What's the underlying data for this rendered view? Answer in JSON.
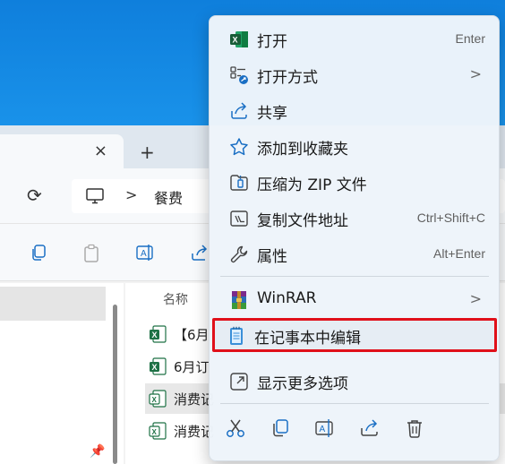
{
  "explorer": {
    "tab_close": "×",
    "tab_new": "+",
    "refresh": "⟳",
    "breadcrumb_separator": ">",
    "breadcrumb_folder": "餐费",
    "column_name_header": "名称",
    "files": [
      {
        "name": "【6月",
        "type": "excel",
        "selected": false
      },
      {
        "name": "6月订",
        "type": "excel",
        "selected": false
      },
      {
        "name": "消费记",
        "type": "csv",
        "selected": true
      },
      {
        "name": "消费记",
        "type": "csv",
        "selected": false
      }
    ],
    "pin_glyph": "📌"
  },
  "context_menu": {
    "items": [
      {
        "id": "open",
        "label": "打开",
        "shortcut": "Enter",
        "icon": "excel-icon"
      },
      {
        "id": "open_with",
        "label": "打开方式",
        "has_submenu": true,
        "submenu_arrow": ">",
        "icon": "open-with-icon"
      },
      {
        "id": "share",
        "label": "共享",
        "icon": "share-icon"
      },
      {
        "id": "favorite",
        "label": "添加到收藏夹",
        "icon": "star-icon"
      },
      {
        "id": "zip",
        "label": "压缩为 ZIP 文件",
        "icon": "zip-icon"
      },
      {
        "id": "copy_path",
        "label": "复制文件地址",
        "shortcut": "Ctrl+Shift+C",
        "icon": "copy-path-icon"
      },
      {
        "id": "properties",
        "label": "属性",
        "shortcut": "Alt+Enter",
        "icon": "wrench-icon"
      },
      {
        "id": "winrar",
        "label": "WinRAR",
        "has_submenu": true,
        "submenu_arrow": ">",
        "icon": "winrar-icon"
      },
      {
        "id": "notepad",
        "label": "在记事本中编辑",
        "highlighted": true,
        "icon": "notepad-icon"
      },
      {
        "id": "more",
        "label": "显示更多选项",
        "icon": "more-options-icon"
      }
    ],
    "quick_actions": [
      "cut-icon",
      "copy-icon",
      "rename-icon",
      "share-icon",
      "delete-icon"
    ],
    "highlight_color": "#e0101a"
  }
}
